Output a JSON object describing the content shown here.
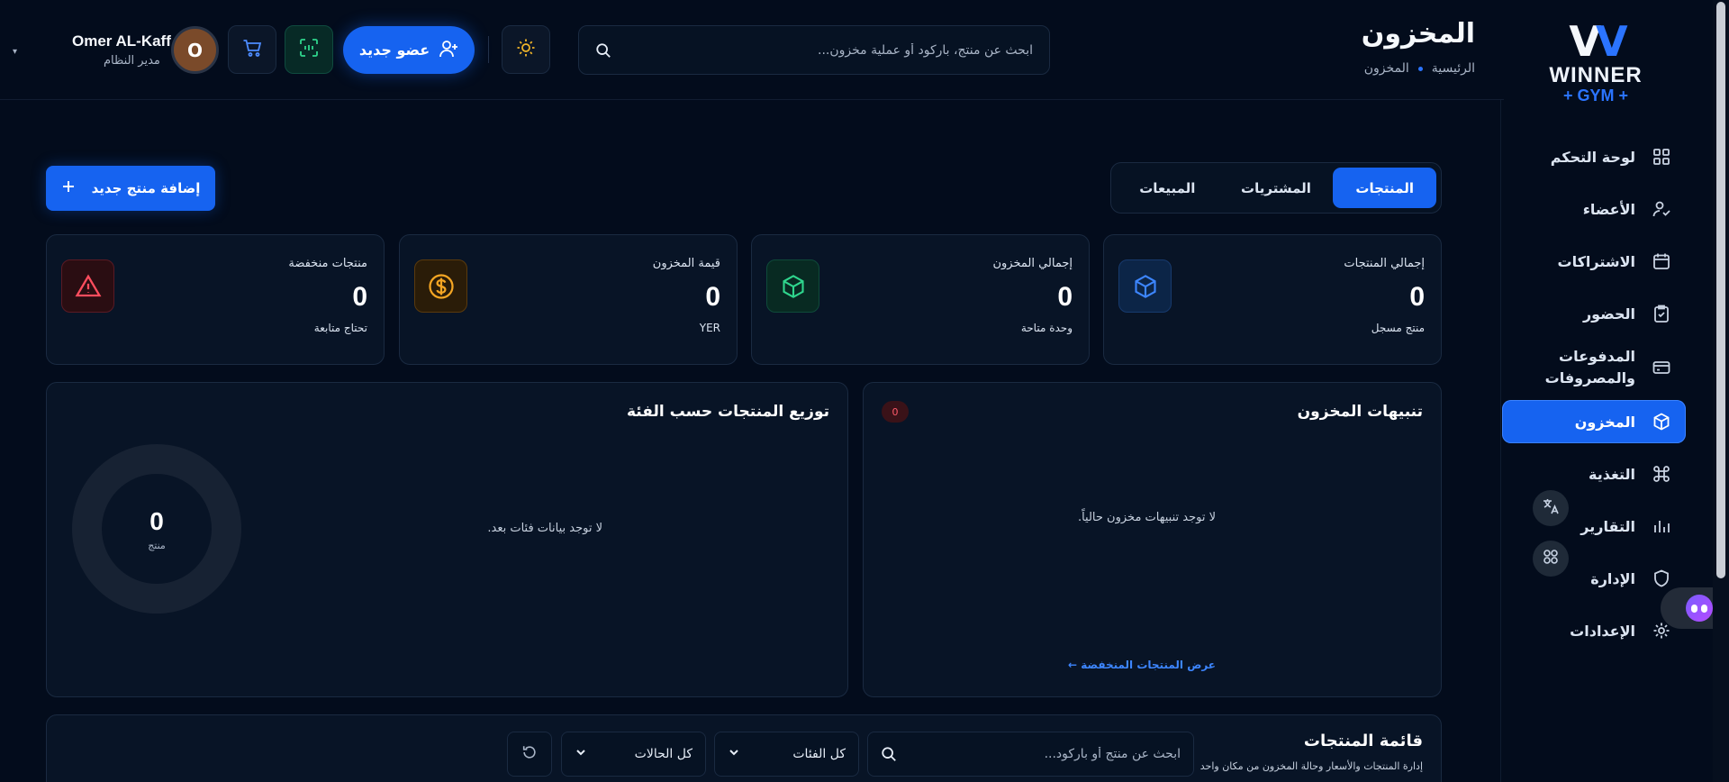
{
  "header": {
    "title": "المخزون",
    "breadcrumb": [
      "الرئيسية",
      "المخزون"
    ],
    "search_placeholder": "ابحث عن منتج، باركود أو عملية مخزون...",
    "new_member_label": "عضو جديد",
    "user": {
      "name": "Omer AL-Kaff",
      "role": "مدير النظام",
      "avatar_letter": "O"
    }
  },
  "brand": {
    "mark_left": "V",
    "mark_right": "V",
    "word": "WINNER",
    "sub": "+ GYM +"
  },
  "sidebar": {
    "items": [
      {
        "label": "لوحة التحكم",
        "icon": "grid-icon",
        "active": false
      },
      {
        "label": "الأعضاء",
        "icon": "user-check-icon",
        "active": false
      },
      {
        "label": "الاشتراكات",
        "icon": "calendar-icon",
        "active": false
      },
      {
        "label": "الحضور",
        "icon": "clipboard-check-icon",
        "active": false
      },
      {
        "label": "المدفوعات والمصروفات",
        "icon": "credit-card-icon",
        "active": false
      },
      {
        "label": "المخزون",
        "icon": "box-icon",
        "active": true
      },
      {
        "label": "التغذية",
        "icon": "command-icon",
        "active": false
      },
      {
        "label": "التقارير",
        "icon": "chart-icon",
        "active": false
      },
      {
        "label": "الإدارة",
        "icon": "shield-icon",
        "active": false
      },
      {
        "label": "الإعدادات",
        "icon": "gear-icon",
        "active": false
      }
    ]
  },
  "tabs": [
    {
      "label": "المنتجات",
      "active": true
    },
    {
      "label": "المشتريات",
      "active": false
    },
    {
      "label": "المبيعات",
      "active": false
    }
  ],
  "add_product_label": "إضافة منتج جديد",
  "stats": [
    {
      "title": "إجمالي المنتجات",
      "value": "0",
      "sub": "منتج مسجل",
      "icon": "cube-icon",
      "color": "#3d86ff"
    },
    {
      "title": "إجمالي المخزون",
      "value": "0",
      "sub": "وحدة متاحة",
      "icon": "package-icon",
      "color": "#2fd58d"
    },
    {
      "title": "قيمة المخزون",
      "value": "0",
      "sub": "YER",
      "icon": "dollar-icon",
      "color": "#f5a623"
    },
    {
      "title": "منتجات منخفضة",
      "value": "0",
      "sub": "تحتاج متابعة",
      "icon": "alert-triangle-icon",
      "color": "#ff4d5e"
    }
  ],
  "alerts_panel": {
    "title": "تنبيهات المخزون",
    "badge": "0",
    "empty": "لا توجد تنبيهات مخزون حالياً.",
    "link": "عرض المنتجات المنخفضة ←"
  },
  "category_panel": {
    "title": "توزيع المنتجات حسب الفئة",
    "empty": "لا توجد بيانات فئات بعد.",
    "donut_value": "0",
    "donut_label": "منتج"
  },
  "products_panel": {
    "title": "قائمة المنتجات",
    "subtitle": "إدارة المنتجات والأسعار وحالة المخزون من مكان واحد",
    "search_placeholder": "ابحث عن منتج أو باركود...",
    "category_filter": "كل الفئات",
    "status_filter": "كل الحالات"
  }
}
